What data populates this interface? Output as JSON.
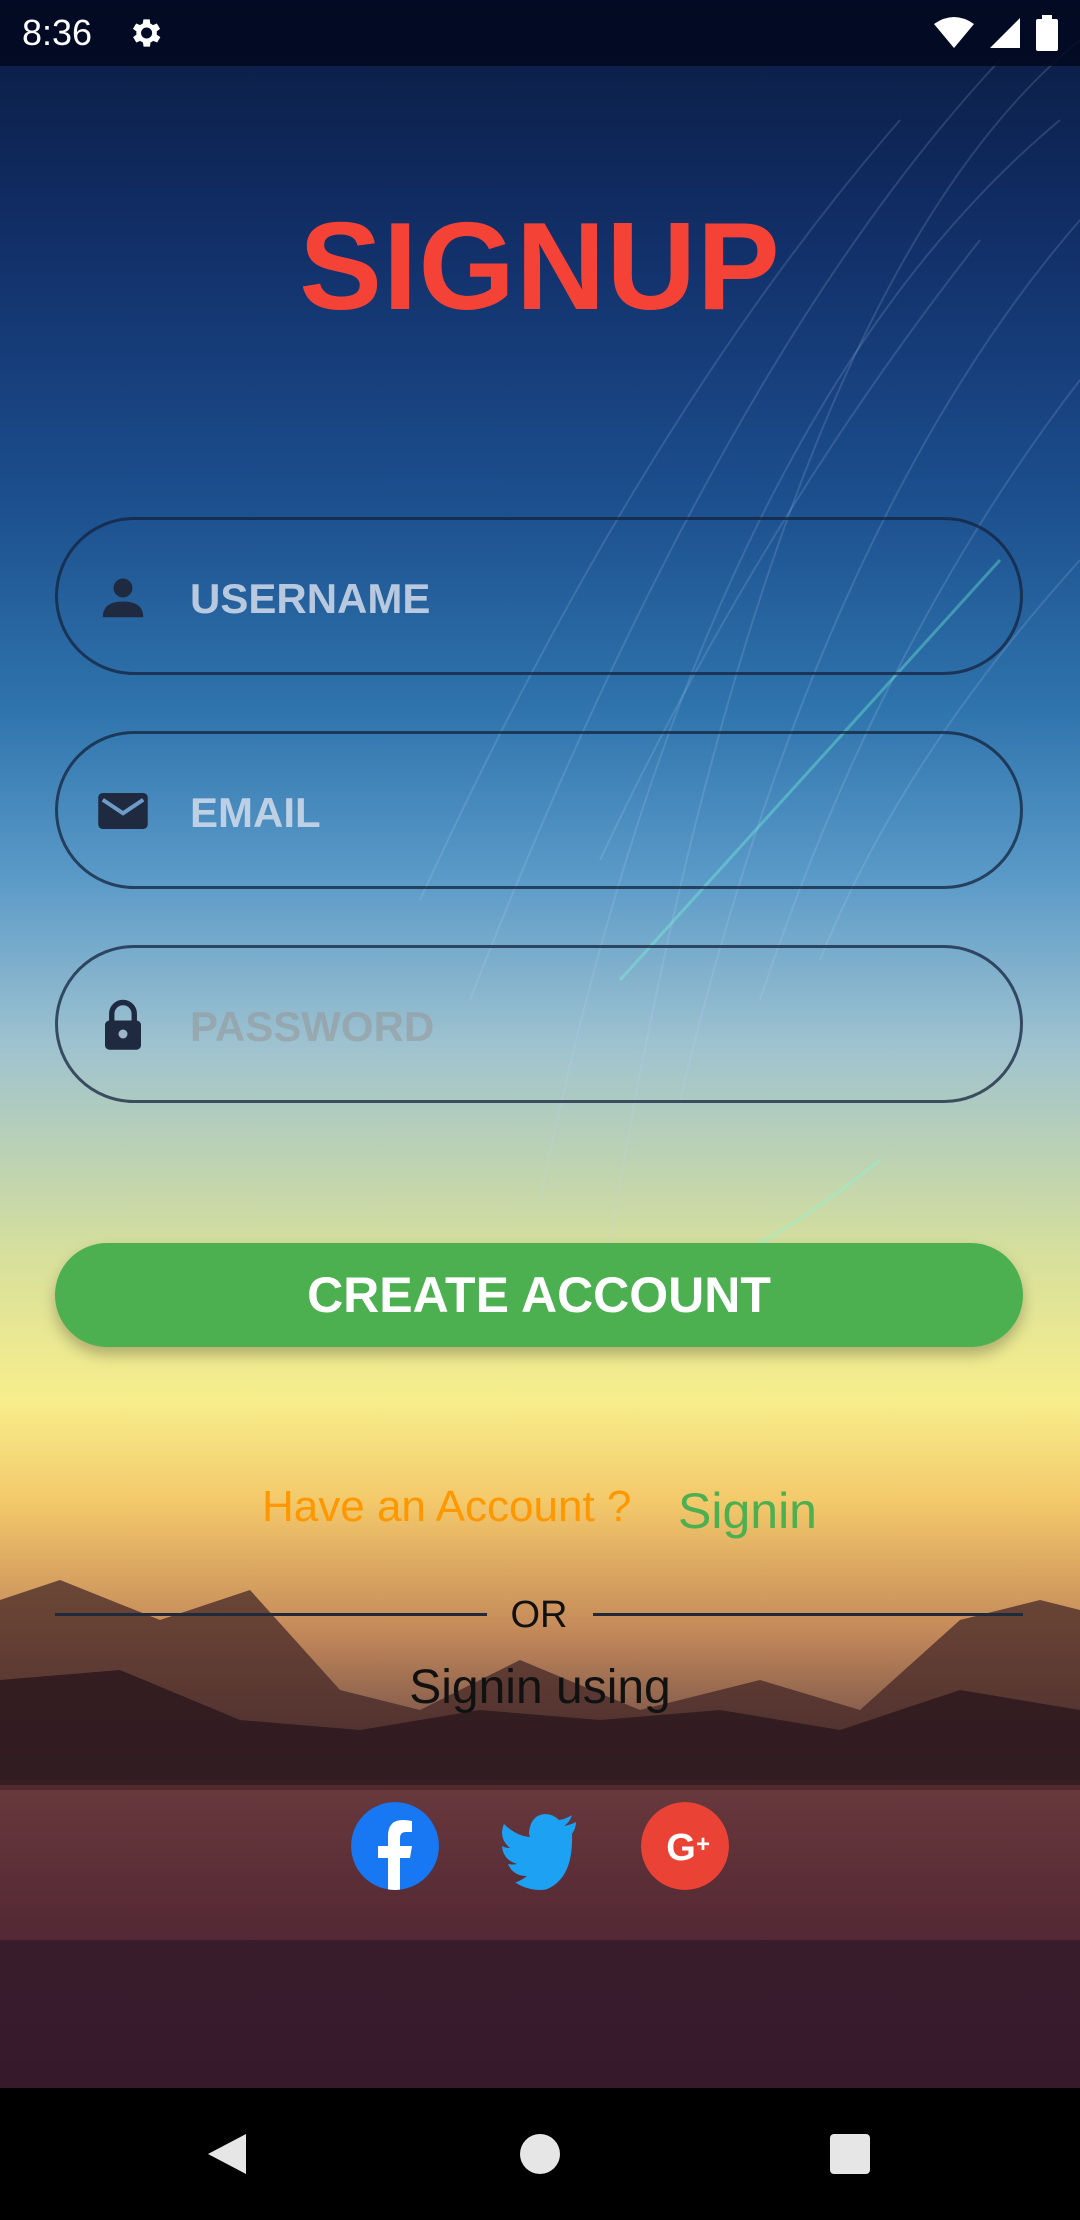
{
  "status_bar": {
    "time": "8:36",
    "icons": [
      "settings-icon",
      "wifi-icon",
      "signal-icon",
      "battery-icon"
    ]
  },
  "page": {
    "title": "SIGNUP"
  },
  "form": {
    "username": {
      "value": "",
      "placeholder": "USERNAME",
      "icon": "person-icon"
    },
    "email": {
      "value": "",
      "placeholder": "EMAIL",
      "icon": "mail-icon"
    },
    "password": {
      "value": "",
      "placeholder": "PASSWORD",
      "icon": "lock-icon"
    },
    "submit_label": "CREATE ACCOUNT"
  },
  "signin_prompt": {
    "text": "Have an Account ?",
    "link": "Signin"
  },
  "divider": {
    "text": "OR"
  },
  "social": {
    "heading": "Signin using",
    "providers": [
      "facebook-icon",
      "twitter-icon",
      "google-plus-icon"
    ]
  },
  "nav_bar": {
    "buttons": [
      "back-icon",
      "home-icon",
      "recents-icon"
    ]
  },
  "colors": {
    "title": "#f44336",
    "button": "#4caf50",
    "have_account": "#ff9800",
    "signin_link": "#4caf50",
    "facebook": "#1877f2",
    "twitter": "#1da1f2",
    "google_plus": "#ea4335"
  }
}
